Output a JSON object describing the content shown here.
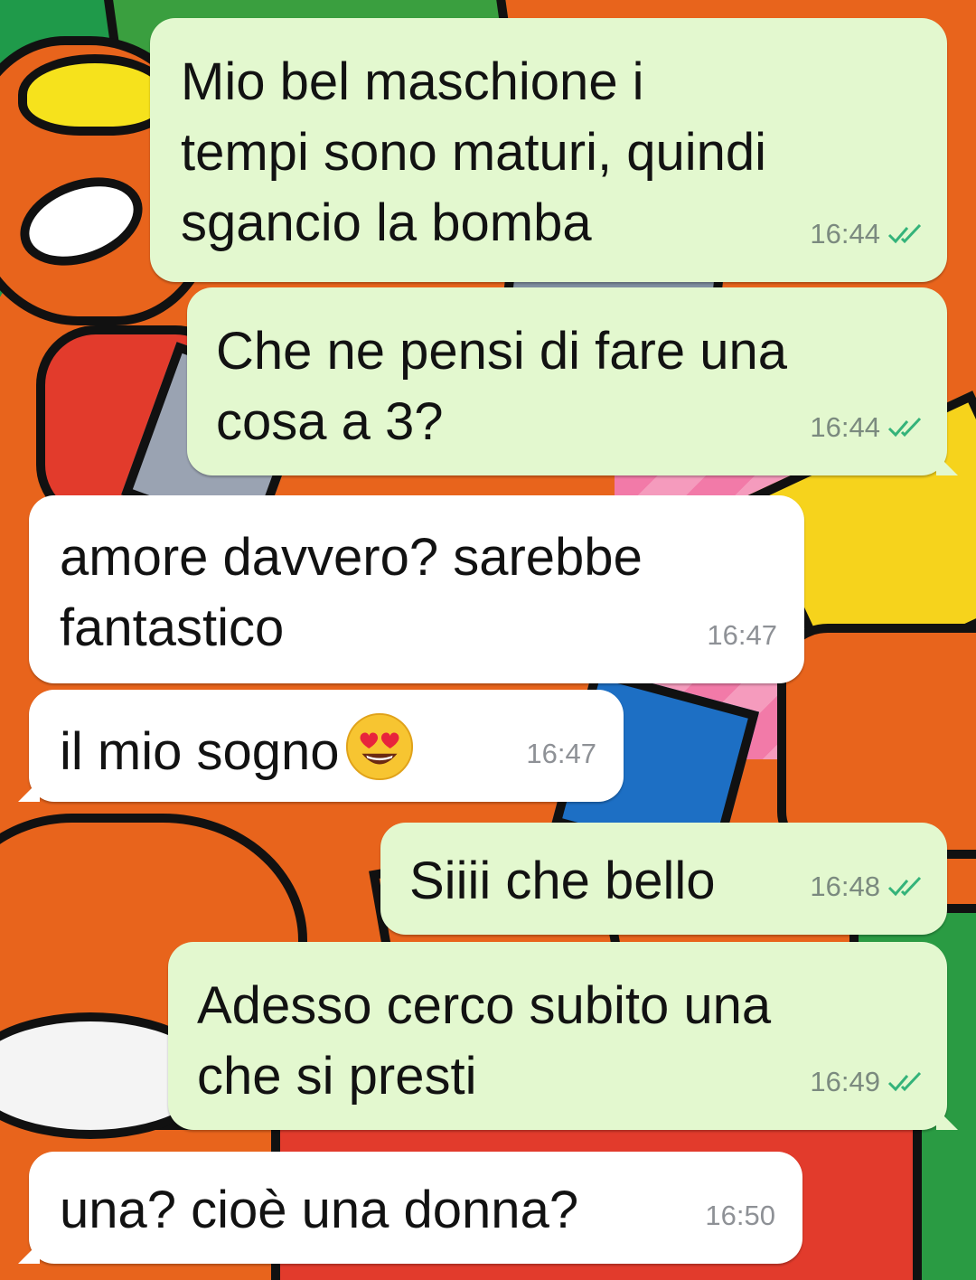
{
  "messages": [
    {
      "direction": "outgoing",
      "text": "Mio bel maschione i\ntempi sono maturi, quindi\nsgancio la bomba",
      "time": "16:44",
      "status": "read"
    },
    {
      "direction": "outgoing",
      "text": "Che ne pensi di fare una\ncosa a 3?",
      "time": "16:44",
      "status": "read"
    },
    {
      "direction": "incoming",
      "text": "amore davvero? sarebbe\nfantastico",
      "time": "16:47"
    },
    {
      "direction": "incoming",
      "text": "il mio sogno",
      "emoji": "heart-eyes",
      "time": "16:47"
    },
    {
      "direction": "outgoing",
      "text": "Siiii che bello",
      "time": "16:48",
      "status": "read"
    },
    {
      "direction": "outgoing",
      "text": "Adesso cerco subito una\nche si presti",
      "time": "16:49",
      "status": "read"
    },
    {
      "direction": "incoming",
      "text": "una? cioè una donna?",
      "time": "16:50"
    }
  ],
  "colors": {
    "outgoing_bubble": "#e3f8cf",
    "incoming_bubble": "#ffffff",
    "read_ticks": "#34b37a",
    "timestamp": "#7b8a7f"
  }
}
